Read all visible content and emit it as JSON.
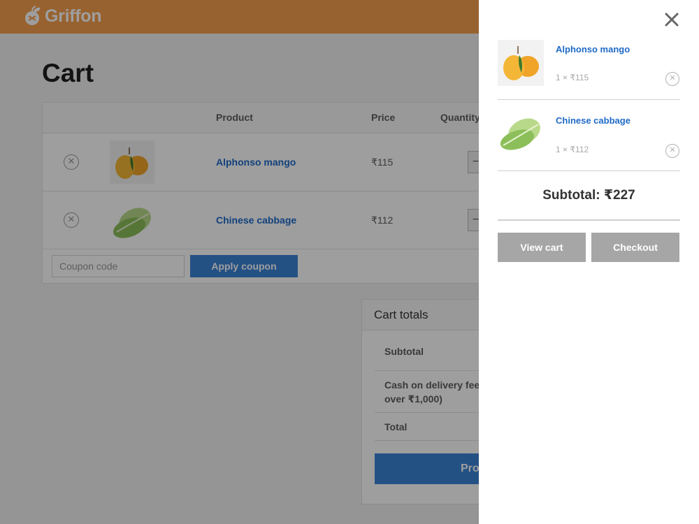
{
  "header": {
    "logo_text": "Griffon",
    "brand_color": "#f49e4c",
    "logo_icon": "fruit-icon"
  },
  "cart_page": {
    "title": "Cart",
    "columns": [
      "Product",
      "Price",
      "Quantity"
    ],
    "rows": [
      {
        "name": "Alphonso mango",
        "price": "₹115",
        "image": "mango-image"
      },
      {
        "name": "Chinese cabbage",
        "price": "₹112",
        "image": "cabbage-image"
      }
    ],
    "coupon_placeholder": "Coupon code",
    "apply_coupon_label": "Apply coupon"
  },
  "cart_totals": {
    "title": "Cart totals",
    "subtotal_label": "Subtotal",
    "cod_fee_label": "Cash on delivery fee (F",
    "cod_fee_label_line2": "over ₹1,000)",
    "total_label": "Total",
    "proceed_label": "Proc"
  },
  "drawer": {
    "items": [
      {
        "name": "Alphonso mango",
        "qty_price": "1 × ₹115",
        "image": "mango-image"
      },
      {
        "name": "Chinese cabbage",
        "qty_price": "1 × ₹112",
        "image": "cabbage-image"
      }
    ],
    "subtotal": "Subtotal: ₹227",
    "view_cart_label": "View cart",
    "checkout_label": "Checkout"
  },
  "colors": {
    "accent_blue": "#3a84d6",
    "link_blue": "#1e6ac8",
    "drawer_button_gray": "#a6a6a6"
  }
}
